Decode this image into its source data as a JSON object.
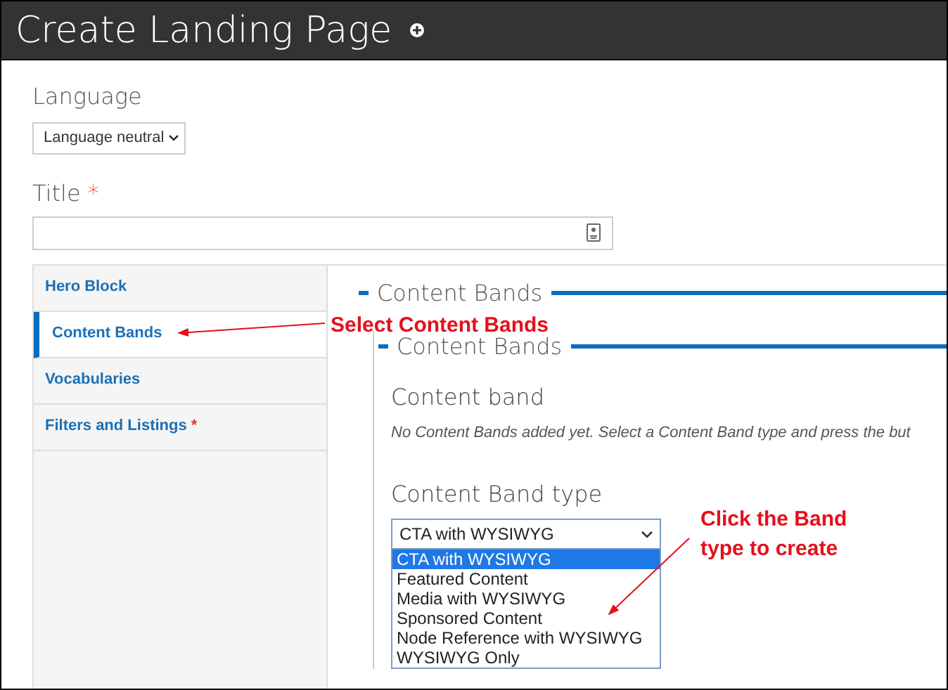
{
  "header": {
    "title": "Create Landing Page"
  },
  "language": {
    "label": "Language",
    "value": "Language neutral"
  },
  "title_field": {
    "label": "Title",
    "required_mark": "*"
  },
  "tabs": [
    {
      "label": "Hero Block",
      "selected": false
    },
    {
      "label": "Content Bands",
      "selected": true
    },
    {
      "label": "Vocabularies",
      "selected": false
    },
    {
      "label": "Filters and Listings",
      "selected": false,
      "required_mark": "*"
    }
  ],
  "outer_legend": "Content Bands",
  "inner_legend": "Content Bands",
  "content_band": {
    "heading": "Content band",
    "message": "No Content Bands added yet. Select a Content Band type and press the but"
  },
  "band_type": {
    "label": "Content Band type",
    "value": "CTA with WYSIWYG",
    "options": [
      {
        "label": "CTA with WYSIWYG",
        "selected": true
      },
      {
        "label": "Featured Content",
        "selected": false
      },
      {
        "label": "Media with WYSIWYG",
        "selected": false
      },
      {
        "label": "Sponsored Content",
        "selected": false
      },
      {
        "label": "Node Reference with WYSIWYG",
        "selected": false
      },
      {
        "label": "WYSIWYG Only",
        "selected": false
      }
    ]
  },
  "annotations": [
    {
      "lines": [
        "Select Content Bands"
      ]
    },
    {
      "lines": [
        "Click the Band",
        "type to create"
      ]
    }
  ]
}
